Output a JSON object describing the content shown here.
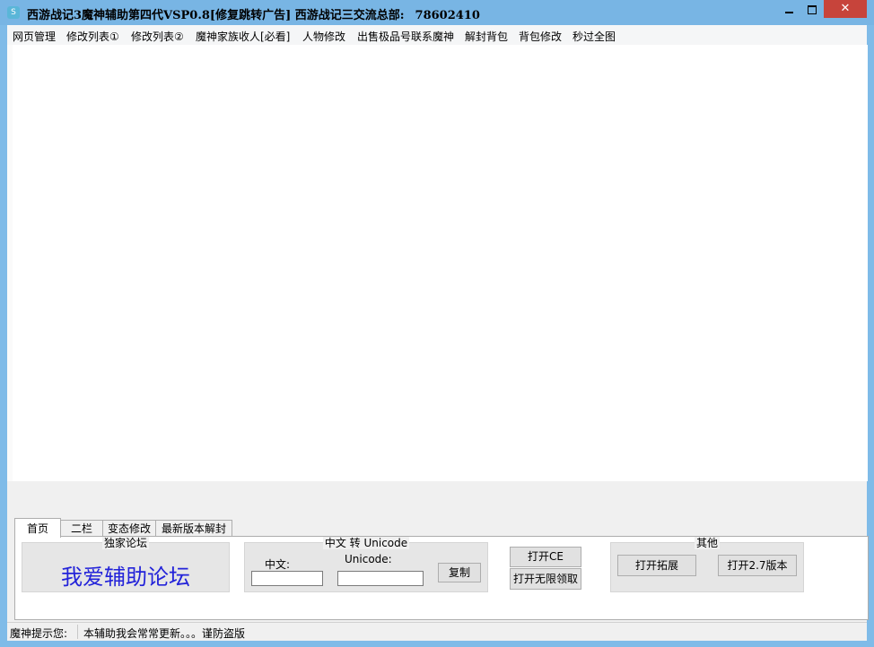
{
  "window": {
    "title": "西游战记3魔神辅助第四代VSP0.8[修复跳转广告] 西游战记三交流总部:",
    "qq": "78602410",
    "icon_label": "S"
  },
  "menu": [
    "网页管理",
    "修改列表①",
    "修改列表②",
    "魔神家族收人[必看]",
    "人物修改",
    "出售极品号联系魔神",
    "解封背包",
    "背包修改",
    "秒过全图"
  ],
  "tabs": [
    "首页",
    "二栏",
    "变态修改",
    "最新版本解封"
  ],
  "forum_group": {
    "title": "独家论坛",
    "link": "我爱辅助论坛"
  },
  "unicode_group": {
    "title": "中文 转 Unicode",
    "chinese_label": "中文:",
    "unicode_label": "Unicode:",
    "chinese_value": "",
    "unicode_value": "",
    "copy_button": "复制"
  },
  "ce_buttons": {
    "open_ce": "打开CE",
    "open_unlimited": "打开无限领取"
  },
  "other_group": {
    "title": "其他",
    "open_extension": "打开拓展",
    "open_v27": "打开2.7版本"
  },
  "status": {
    "label": "魔神提示您:",
    "message": "本辅助我会常常更新。。。谨防盗版"
  }
}
